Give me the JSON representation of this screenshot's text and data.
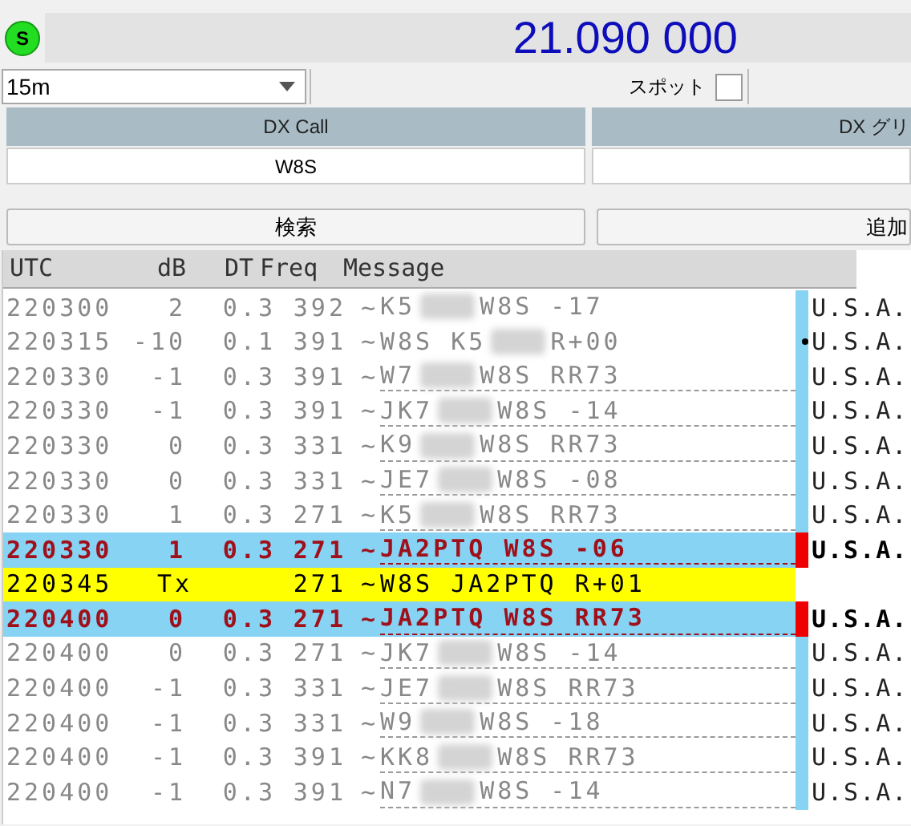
{
  "status_badge": "S",
  "frequency": "21.090 000",
  "band": {
    "value": "15m"
  },
  "spot": {
    "label": "スポット",
    "checked": false
  },
  "dx_call": {
    "header": "DX Call",
    "value": "W8S"
  },
  "dx_grid": {
    "header": "DX グリ"
  },
  "buttons": [
    "検索",
    "追加"
  ],
  "table": {
    "columns": [
      "UTC",
      "dB",
      "DT",
      "Freq",
      "Message"
    ],
    "rows": [
      {
        "kind": "rx",
        "utc": "220300",
        "db": "2",
        "dt": "0.3",
        "freq": "392",
        "sep": "~",
        "msg_start": "K5",
        "msg_end": "W8S -17",
        "country": "U.S.A.",
        "underlined": false,
        "dotted": false
      },
      {
        "kind": "rx",
        "utc": "220315",
        "db": "-10",
        "dt": "0.1",
        "freq": "391",
        "sep": "~",
        "msg_start": "W8S K5",
        "msg_end": "R+00",
        "country": "U.S.A.",
        "underlined": false,
        "dotted": true
      },
      {
        "kind": "rx",
        "utc": "220330",
        "db": "-1",
        "dt": "0.3",
        "freq": "391",
        "sep": "~",
        "msg_start": "W7",
        "msg_end": "W8S RR73",
        "country": "U.S.A.",
        "underlined": true,
        "dotted": false
      },
      {
        "kind": "rx",
        "utc": "220330",
        "db": "-1",
        "dt": "0.3",
        "freq": "391",
        "sep": "~",
        "msg_start": "JK7",
        "msg_end": "W8S -14",
        "country": "U.S.A.",
        "underlined": true,
        "dotted": false
      },
      {
        "kind": "rx",
        "utc": "220330",
        "db": "0",
        "dt": "0.3",
        "freq": "331",
        "sep": "~",
        "msg_start": "K9",
        "msg_end": "W8S RR73",
        "country": "U.S.A.",
        "underlined": true,
        "dotted": false
      },
      {
        "kind": "rx",
        "utc": "220330",
        "db": "0",
        "dt": "0.3",
        "freq": "331",
        "sep": "~",
        "msg_start": "JE7",
        "msg_end": "W8S -08",
        "country": "U.S.A.",
        "underlined": true,
        "dotted": false
      },
      {
        "kind": "rx",
        "utc": "220330",
        "db": "1",
        "dt": "0.3",
        "freq": "271",
        "sep": "~",
        "msg_start": "K5",
        "msg_end": "W8S RR73",
        "country": "U.S.A.",
        "underlined": true,
        "dotted": false
      },
      {
        "kind": "mine",
        "utc": "220330",
        "db": "1",
        "dt": "0.3",
        "freq": "271",
        "sep": "~",
        "msg_end": "JA2PTQ W8S -06",
        "country": "U.S.A.",
        "underlined": true,
        "dotted": false
      },
      {
        "kind": "tx",
        "utc": "220345",
        "db": "Tx",
        "freq": "271",
        "sep": "~",
        "msg_end": "W8S JA2PTQ R+01",
        "underlined": false,
        "dotted": false
      },
      {
        "kind": "mine",
        "utc": "220400",
        "db": "0",
        "dt": "0.3",
        "freq": "271",
        "sep": "~",
        "msg_end": "JA2PTQ W8S RR73",
        "country": "U.S.A.",
        "underlined": true,
        "dotted": false
      },
      {
        "kind": "rx",
        "utc": "220400",
        "db": "0",
        "dt": "0.3",
        "freq": "271",
        "sep": "~",
        "msg_start": "JK7",
        "msg_end": "W8S -14",
        "country": "U.S.A.",
        "underlined": true,
        "dotted": false
      },
      {
        "kind": "rx",
        "utc": "220400",
        "db": "-1",
        "dt": "0.3",
        "freq": "331",
        "sep": "~",
        "msg_start": "JE7",
        "msg_end": "W8S RR73",
        "country": "U.S.A.",
        "underlined": true,
        "dotted": false
      },
      {
        "kind": "rx",
        "utc": "220400",
        "db": "-1",
        "dt": "0.3",
        "freq": "331",
        "sep": "~",
        "msg_start": "W9",
        "msg_end": "W8S -18",
        "country": "U.S.A.",
        "underlined": true,
        "dotted": false
      },
      {
        "kind": "rx",
        "utc": "220400",
        "db": "-1",
        "dt": "0.3",
        "freq": "391",
        "sep": "~",
        "msg_start": "KK8",
        "msg_end": "W8S RR73",
        "country": "U.S.A.",
        "underlined": true,
        "dotted": false
      },
      {
        "kind": "rx",
        "utc": "220400",
        "db": "-1",
        "dt": "0.3",
        "freq": "391",
        "sep": "~",
        "msg_start": "N7",
        "msg_end": "W8S -14",
        "country": "U.S.A.",
        "underlined": true,
        "dotted": false
      }
    ]
  }
}
